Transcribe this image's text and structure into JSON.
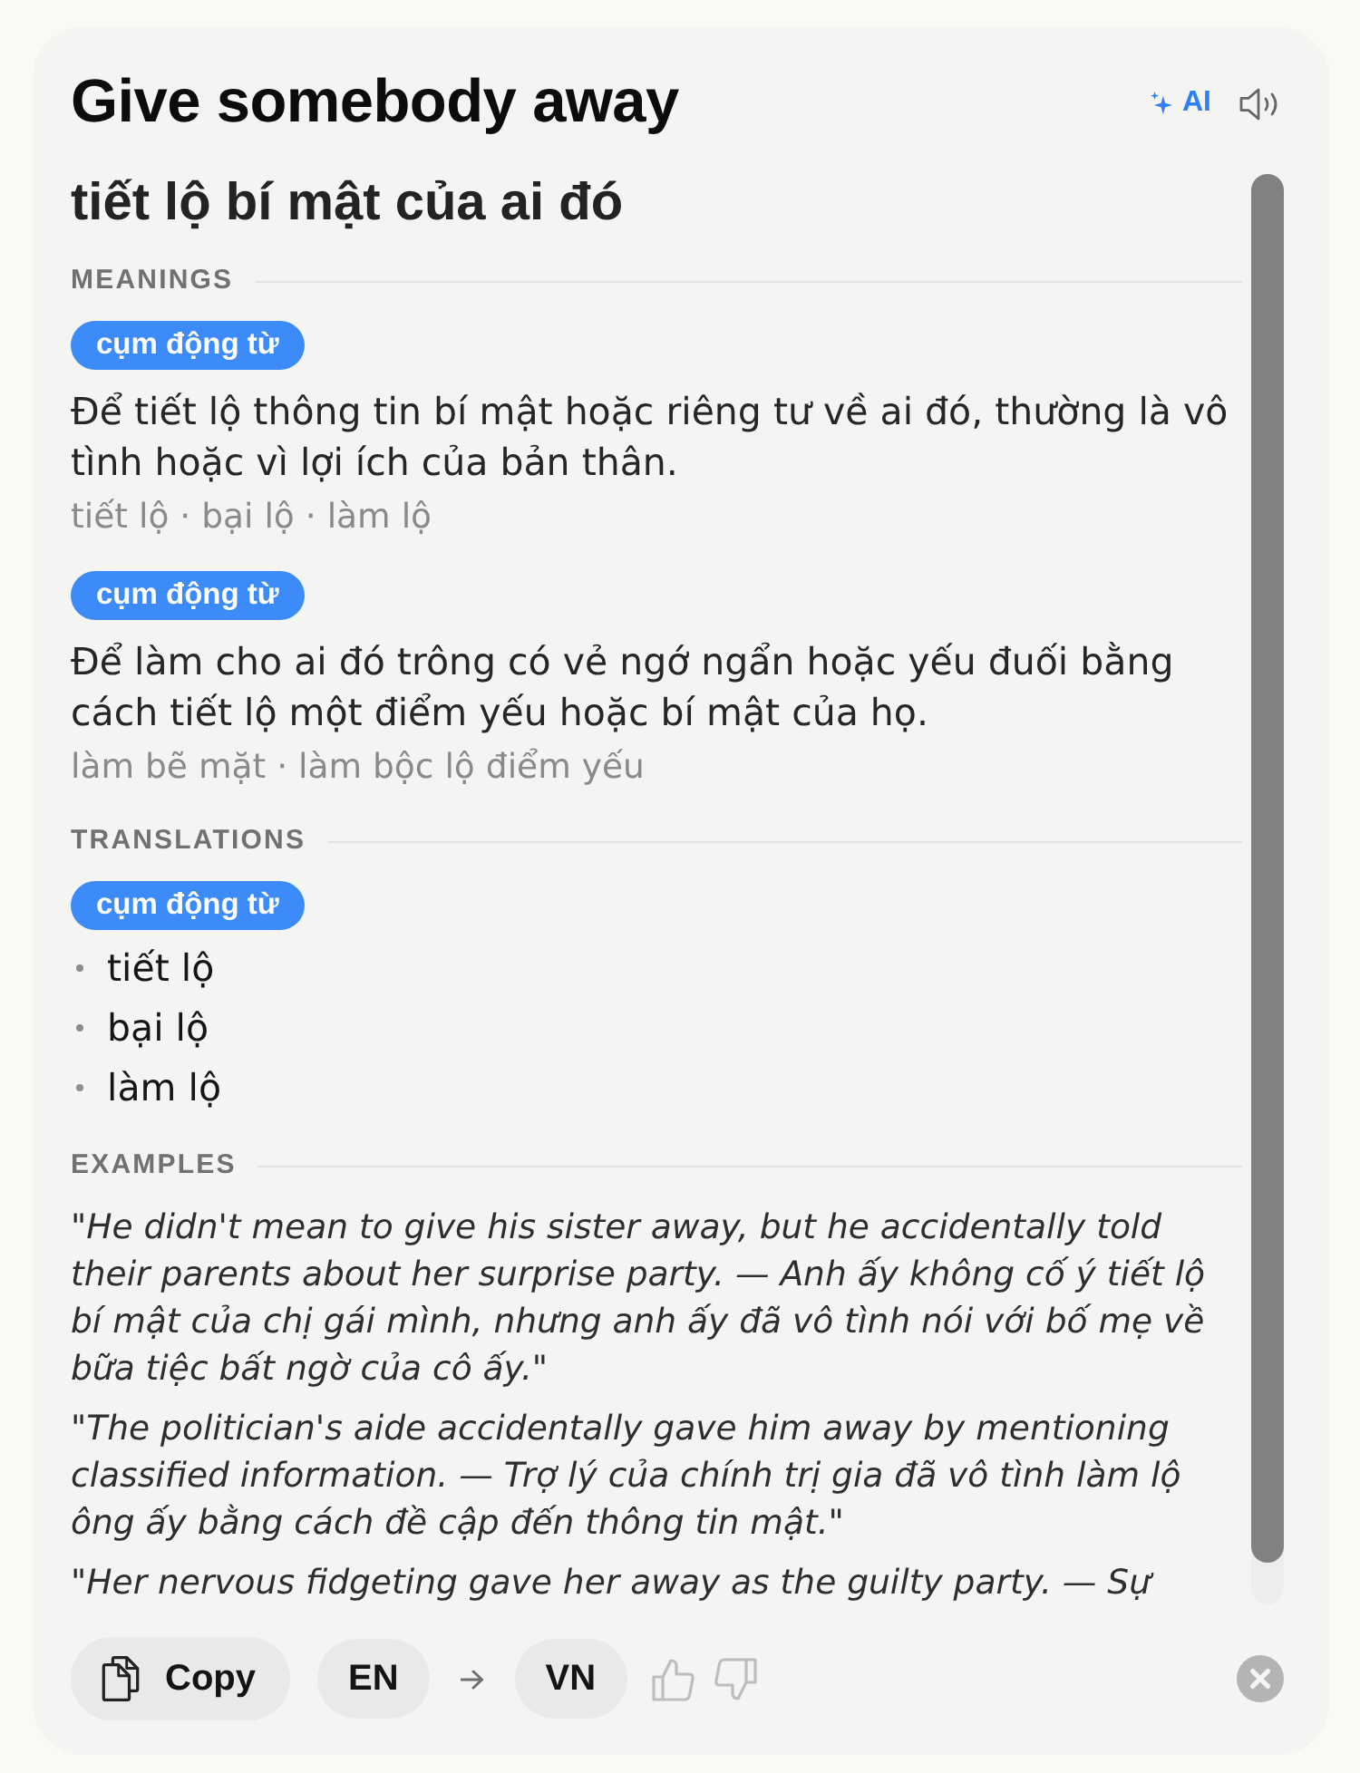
{
  "header": {
    "title": "Give somebody away",
    "ai_label": "AI"
  },
  "phrase_translation": "tiết lộ bí mật của ai đó",
  "meanings": {
    "heading": "MEANINGS",
    "items": [
      {
        "part_of_speech": "cụm động từ",
        "definition": "Để tiết lộ thông tin bí mật hoặc riêng tư về ai đó, thường là vô tình hoặc vì lợi ích của bản thân.",
        "synonyms": "tiết lộ · bại lộ · làm lộ"
      },
      {
        "part_of_speech": "cụm động từ",
        "definition": "Để làm cho ai đó trông có vẻ ngớ ngẩn hoặc yếu đuối bằng cách tiết lộ một điểm yếu hoặc bí mật của họ.",
        "synonyms": "làm bẽ mặt · làm bộc lộ điểm yếu"
      }
    ]
  },
  "translations": {
    "heading": "TRANSLATIONS",
    "groups": [
      {
        "part_of_speech": "cụm động từ",
        "items": [
          "tiết lộ",
          "bại lộ",
          "làm lộ"
        ]
      }
    ]
  },
  "examples": {
    "heading": "EXAMPLES",
    "items": [
      "\"He didn't mean to give his sister away, but he accidentally told their parents about her surprise party. — Anh ấy không cố ý tiết lộ bí mật của chị gái mình, nhưng anh ấy đã vô tình nói với bố mẹ về bữa tiệc bất ngờ của cô ấy.\"",
      "\"The politician's aide accidentally gave him away by mentioning classified information. — Trợ lý của chính trị gia đã vô tình làm lộ ông ấy bằng cách đề cập đến thông tin mật.\"",
      "\"Her nervous fidgeting gave her away as the guilty party. — Sự"
    ]
  },
  "footer": {
    "copy_label": "Copy",
    "source_language": "EN",
    "target_language": "VN"
  }
}
